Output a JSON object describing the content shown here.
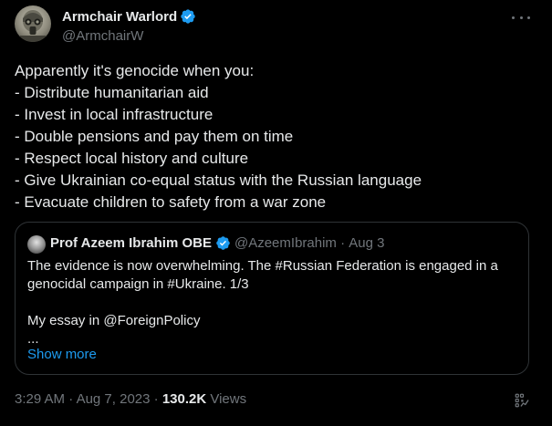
{
  "author": {
    "name": "Armchair Warlord",
    "handle": "@ArmchairW",
    "verified": true
  },
  "tweet": {
    "lines": [
      "Apparently it's genocide when you:",
      "- Distribute humanitarian aid",
      "- Invest in local infrastructure",
      "- Double pensions and pay them on time",
      "- Respect local history and culture",
      "- Give Ukrainian co-equal status with the Russian language",
      "- Evacuate children to safety from a war zone"
    ]
  },
  "quote": {
    "name": "Prof Azeem Ibrahim OBE",
    "handle": "@AzeemIbrahim",
    "separator": " · ",
    "date": "Aug 3",
    "lines": [
      "The evidence is now overwhelming. The #Russian Federation is engaged in a",
      "genocidal campaign in #Ukraine. 1/3",
      "",
      "My essay in @ForeignPolicy",
      "..."
    ],
    "show_more": "Show more"
  },
  "footer": {
    "time": "3:29 AM",
    "separator": " · ",
    "date": "Aug 7, 2023",
    "separator2": " · ",
    "views_count": "130.2K",
    "views_label": "Views"
  },
  "colors": {
    "background": "#000000",
    "text": "#e7e9ea",
    "muted": "#71767b",
    "accent": "#1d9bf0",
    "border": "#2f3336"
  },
  "icons": {
    "verified": "verified-badge-icon",
    "more": "more-horizontal-icon",
    "analytics": "analytics-icon"
  }
}
